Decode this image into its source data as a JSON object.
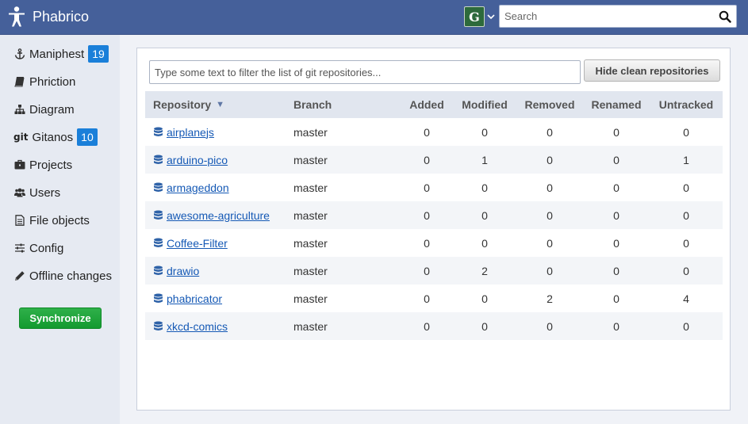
{
  "app": {
    "title": "Phabrico"
  },
  "header": {
    "avatar_letter": "G",
    "search_placeholder": "Search"
  },
  "sidebar": {
    "items": [
      {
        "label": "Maniphest",
        "icon": "anchor-icon",
        "badge": "19"
      },
      {
        "label": "Phriction",
        "icon": "book-icon"
      },
      {
        "label": "Diagram",
        "icon": "sitemap-icon"
      },
      {
        "label": "Gitanos",
        "icon": "git-icon",
        "icon_text": "git",
        "badge": "10"
      },
      {
        "label": "Projects",
        "icon": "briefcase-icon"
      },
      {
        "label": "Users",
        "icon": "users-icon"
      },
      {
        "label": "File objects",
        "icon": "file-icon"
      },
      {
        "label": "Config",
        "icon": "sliders-icon"
      },
      {
        "label": "Offline changes",
        "icon": "pencil-icon"
      }
    ],
    "sync_label": "Synchronize"
  },
  "main": {
    "filter_placeholder": "Type some text to filter the list of git repositories...",
    "hide_clean_label": "Hide clean repositories",
    "columns": [
      "Repository",
      "Branch",
      "Added",
      "Modified",
      "Removed",
      "Renamed",
      "Untracked"
    ],
    "sort_indicator": "▼",
    "rows": [
      {
        "repository": "airplanejs",
        "branch": "master",
        "added": "0",
        "modified": "0",
        "removed": "0",
        "renamed": "0",
        "untracked": "0"
      },
      {
        "repository": "arduino-pico",
        "branch": "master",
        "added": "0",
        "modified": "1",
        "removed": "0",
        "renamed": "0",
        "untracked": "1"
      },
      {
        "repository": "armageddon",
        "branch": "master",
        "added": "0",
        "modified": "0",
        "removed": "0",
        "renamed": "0",
        "untracked": "0"
      },
      {
        "repository": "awesome-agriculture",
        "branch": "master",
        "added": "0",
        "modified": "0",
        "removed": "0",
        "renamed": "0",
        "untracked": "0"
      },
      {
        "repository": "Coffee-Filter",
        "branch": "master",
        "added": "0",
        "modified": "0",
        "removed": "0",
        "renamed": "0",
        "untracked": "0"
      },
      {
        "repository": "drawio",
        "branch": "master",
        "added": "0",
        "modified": "2",
        "removed": "0",
        "renamed": "0",
        "untracked": "0"
      },
      {
        "repository": "phabricator",
        "branch": "master",
        "added": "0",
        "modified": "0",
        "removed": "2",
        "renamed": "0",
        "untracked": "4"
      },
      {
        "repository": "xkcd-comics",
        "branch": "master",
        "added": "0",
        "modified": "0",
        "removed": "0",
        "renamed": "0",
        "untracked": "0"
      }
    ]
  },
  "colors": {
    "header_bg": "#45609a",
    "sidebar_bg": "#e6eaf2",
    "badge": "#1a7fd9",
    "sync_button": "#139a2f",
    "link": "#1559b5"
  }
}
